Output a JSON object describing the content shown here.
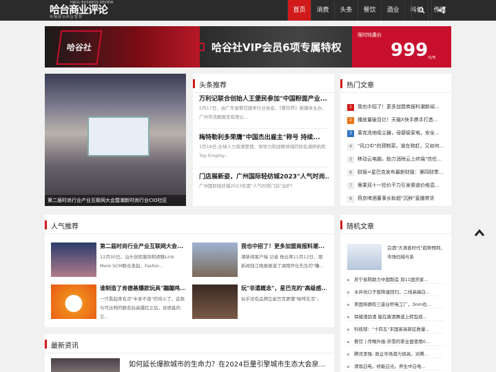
{
  "site": {
    "logo_cn": "哈台商业评论",
    "logo_en": "HAGU BUSINESS REVIEW",
    "logo_sub": "传播成功商业智慧"
  },
  "nav": {
    "items": [
      "首页",
      "消费",
      "头条",
      "餐饮",
      "酒业",
      "科创",
      "传媒"
    ],
    "active_index": 0,
    "search_icon": "search-icon",
    "share_icon": "share-icon"
  },
  "banner": {
    "side_text": "哈谷社VIP",
    "title": "哈谷社VIP会员6项专属特权",
    "price_label": "限时特惠价",
    "price": "999",
    "price_unit": "元/年"
  },
  "slider": {
    "caption": "第二届时尚行业产业互联网大会暨潮新时尚行业CIO社区"
  },
  "headline": {
    "title": "头条推荐",
    "articles": [
      {
        "title": "万利记联合创始人王堡民参加\"中国粉面产业...",
        "summary": "5月17日，由广东省餐饮服务行业协会、《餐饮界》新媒体主办，广州市浩联展览有限公..."
      },
      {
        "title": "梅特勒利多荣膺\"中国杰出雇主\"称号 持续...",
        "summary": "1月18日,全球人力资源管理、领导力和战略领域的知名调研机构Top Employ..."
      },
      {
        "title": "门店展新姿，广州国际轻纺城2023\"人气时尚...",
        "summary": "广州国际轻纺城2023年度\"人气时尚门店\"出炉！"
      }
    ]
  },
  "hot": {
    "title": "热门文章",
    "items": [
      "我也中招了！更多加盟商报料潮新闻...",
      "播放量破百亿！天猫X快手携手打造...",
      "莱克洗地吸尘器，母婴级家电，安全...",
      "\"风口中\"的预制菜，谁在称赶，又如何...",
      "移动云电脑，助力消除云上终端\"信任...",
      "财报=星巴克发布最新财报：第四财季...",
      "箫乘双十一捡价不力引发渠道价格混...",
      "燕京啤酒董事长耿超\"沉醉\"直播带货"
    ]
  },
  "popular": {
    "title": "人气推荐",
    "cards": [
      {
        "title": "第二届时尚行业产业互联网大会...",
        "summary": "12月30日，汕头创奕服饰和德魅Link More SCM联合发起，Fashio..."
      },
      {
        "title": "我也中招了！更多加盟商报料潮...",
        "summary": "潮新闻客户端 记者 杨云寒11月12日，潮新闻钱江晚报报道了湖南怀化先生的\"糟..."
      },
      {
        "title": "谁制造了肯德基爆款玩具\"蹦蹦鸡...",
        "summary": "一只看起来有点\"半身不遂\"的鸡火了，这款与可达鸭的联名玩具爆红之后，肯德基的又..."
      },
      {
        "title": "玩\"非遗概念\"，星巴克的\"高级感...",
        "summary": "似乎没有品牌比星巴克更懂\"咖啡生活\"。"
      }
    ]
  },
  "random": {
    "title": "随机文章",
    "feature": "白酒\"大清香时代\"趋势预判、市场扫描与系",
    "items": [
      "苏宁易购助力中国制造 双11国货家...",
      "水井坊口子窖降速回归，二线高端白...",
      "美国将拥有三座台积电工厂，3nm也...",
      "保健酒劲酒 能在酱酒赛道上转型成...",
      "科技部：\"十四五\"末国家高新区数量...",
      "餐饮丨传略升级:奈雪的茶全面使用0...",
      "腾讯李强: 政企市场潜力很高，对腾...",
      "清翁白电，修能白光，养生中白电..."
    ]
  },
  "latest": {
    "title": "最新资讯",
    "first_title": "如何延长爆款城市的生命力？在2024巨量引擎城市生态大会泉..."
  }
}
